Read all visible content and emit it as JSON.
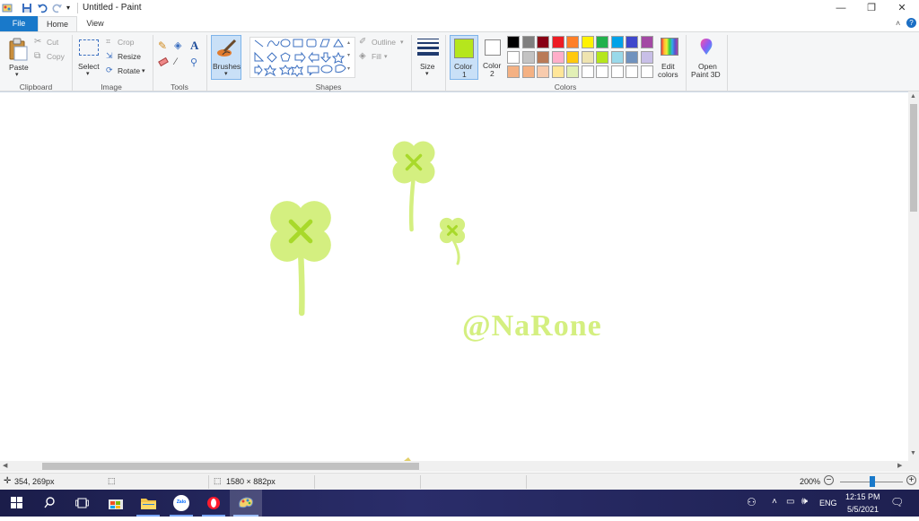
{
  "window": {
    "title": "Untitled - Paint",
    "minimize_glyph": "—",
    "restore_glyph": "❐",
    "close_glyph": "✕"
  },
  "tabs": [
    {
      "label": "File"
    },
    {
      "label": "Home"
    },
    {
      "label": "View"
    }
  ],
  "ribbon": {
    "clipboard": {
      "label": "Clipboard",
      "paste": "Paste",
      "cut": "Cut",
      "copy": "Copy"
    },
    "image": {
      "label": "Image",
      "select": "Select",
      "crop": "Crop",
      "resize": "Resize",
      "rotate": "Rotate"
    },
    "tools": {
      "label": "Tools"
    },
    "brushes": {
      "label": "Brushes"
    },
    "shapes": {
      "label": "Shapes",
      "outline": "Outline",
      "fill": "Fill"
    },
    "size": {
      "label": "Size"
    },
    "color1": {
      "label": "Color",
      "num": "1",
      "value": "#b5e61d"
    },
    "color2": {
      "label": "Color",
      "num": "2",
      "value": "#ffffff"
    },
    "colors": {
      "label": "Colors"
    },
    "edit_colors": {
      "line1": "Edit",
      "line2": "colors"
    },
    "paint3d": {
      "line1": "Open",
      "line2": "Paint 3D"
    }
  },
  "palette": [
    "#000000",
    "#7f7f7f",
    "#880015",
    "#ed1c24",
    "#ff7f27",
    "#fff200",
    "#22b14c",
    "#00a2e8",
    "#3f48cc",
    "#a349a4",
    "#ffffff",
    "#c3c3c3",
    "#b97a57",
    "#ffaec9",
    "#ffc90e",
    "#efe4b0",
    "#b5e61d",
    "#99d9ea",
    "#7092be",
    "#c8bfe7",
    "#f4b183",
    "#f4b183",
    "#f8cbad",
    "#ffe699",
    "#e2f0b6",
    "#ffffff",
    "#ffffff",
    "#ffffff",
    "#ffffff",
    "#ffffff"
  ],
  "canvas": {
    "watermark": "@NaRone",
    "clover_color": "#d4ef80",
    "clover_mark_color": "#a8d92a"
  },
  "status": {
    "cursor": "354, 269px",
    "dimensions": "1580 × 882px",
    "zoom": "200%"
  },
  "taskbar": {
    "lang": "ENG",
    "time": "12:15 PM",
    "date": "5/5/2021",
    "zalo_label": "Zalo"
  }
}
